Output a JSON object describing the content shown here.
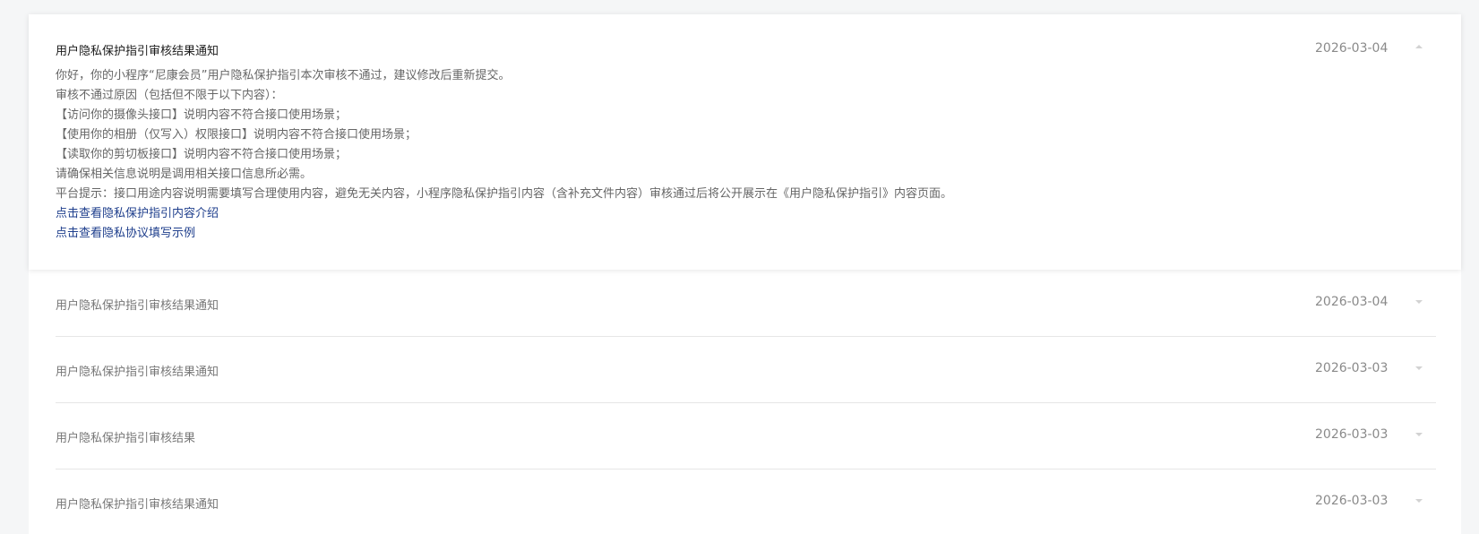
{
  "notifications": {
    "expanded": {
      "title": "用户隐私保护指引审核结果通知",
      "date": "2026-03-04",
      "lines": [
        "你好，你的小程序“尼康会员”用户隐私保护指引本次审核不通过，建议修改后重新提交。",
        "审核不通过原因（包括但不限于以下内容）：",
        "【访问你的摄像头接口】说明内容不符合接口使用场景；",
        "【使用你的相册（仅写入）权限接口】说明内容不符合接口使用场景；",
        "【读取你的剪切板接口】说明内容不符合接口使用场景；",
        "请确保相关信息说明是调用相关接口信息所必需。",
        "平台提示：接口用途内容说明需要填写合理使用内容，避免无关内容，小程序隐私保护指引内容（含补充文件内容）审核通过后将公开展示在《用户隐私保护指引》内容页面。"
      ],
      "links": [
        "点击查看隐私保护指引内容介绍",
        "点击查看隐私协议填写示例"
      ]
    },
    "collapsed": [
      {
        "title": "用户隐私保护指引审核结果通知",
        "date": "2026-03-04"
      },
      {
        "title": "用户隐私保护指引审核结果通知",
        "date": "2026-03-03"
      },
      {
        "title": "用户隐私保护指引审核结果",
        "date": "2026-03-03"
      },
      {
        "title": "用户隐私保护指引审核结果通知",
        "date": "2026-03-03"
      }
    ]
  },
  "icons": {
    "collapse": "caret-up-icon",
    "expand": "caret-down-icon"
  },
  "colors": {
    "link": "#1e3e8c",
    "title_active": "#1a1a1a",
    "text": "#666666",
    "date": "#8a8a8a"
  }
}
